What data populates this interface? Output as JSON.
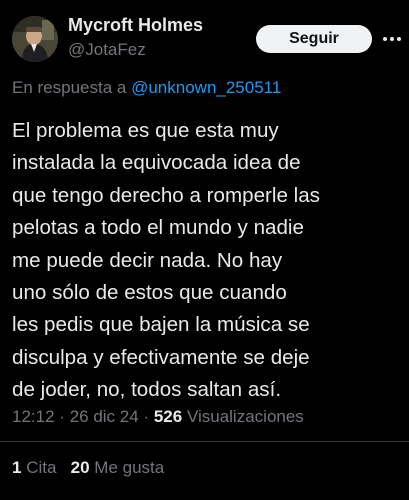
{
  "author": {
    "name": "Mycroft Holmes",
    "handle": "@JotaFez"
  },
  "follow_button": {
    "label": "Seguir"
  },
  "more_button": {
    "icon": "more-horizontal-icon"
  },
  "reply": {
    "prefix": "En respuesta a",
    "mention": "@unknown_250511"
  },
  "tweet": {
    "lines": [
      "El problema es que esta muy",
      "instalada la equivocada idea de",
      "que tengo derecho a romperle las",
      "pelotas a todo el mundo y nadie",
      "me puede decir nada. No hay",
      "uno sólo de estos que cuando",
      "les pedis que bajen la música se",
      "disculpa y efectivamente se deje",
      "de joder, no, todos saltan así."
    ]
  },
  "meta": {
    "time": "12:12",
    "date": "26 dic 24",
    "views_count": "526",
    "views_label": "Visualizaciones"
  },
  "stats": {
    "quotes_count": "1",
    "quotes_label": "Cita",
    "likes_count": "20",
    "likes_label": "Me gusta"
  },
  "colors": {
    "background": "#000000",
    "text": "#e7e9ea",
    "secondary": "#71767b",
    "link": "#1d9bf0",
    "button_bg": "#eff3f4",
    "divider": "#2f3336"
  }
}
